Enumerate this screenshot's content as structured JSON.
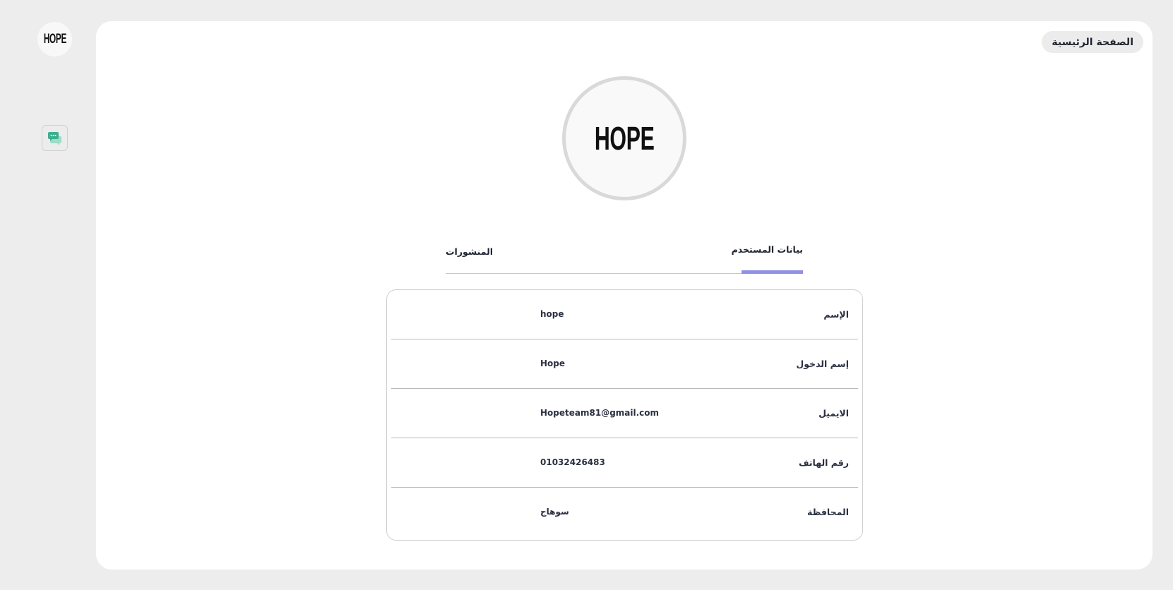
{
  "sidebar": {
    "logo_text": "HOPE",
    "chat_icon": "chat-bubbles-icon",
    "accent_color": "#3bb08f"
  },
  "header": {
    "home_label": "الصفحة الرئيسية"
  },
  "profile": {
    "avatar_text": "HOPE"
  },
  "tabs": [
    {
      "label": "بيانات المستخدم",
      "active": true
    },
    {
      "label": "المنشورات",
      "active": false
    }
  ],
  "tab_accent_color": "#9090e6",
  "fields": [
    {
      "label": "الإسم",
      "value": "hope"
    },
    {
      "label": "إسم الدخول",
      "value": "Hope"
    },
    {
      "label": "الايميل",
      "value": "Hopeteam81@gmail.com"
    },
    {
      "label": "رقم الهاتف",
      "value": "01032426483"
    },
    {
      "label": "المحافظة",
      "value": "سوهاج"
    }
  ]
}
